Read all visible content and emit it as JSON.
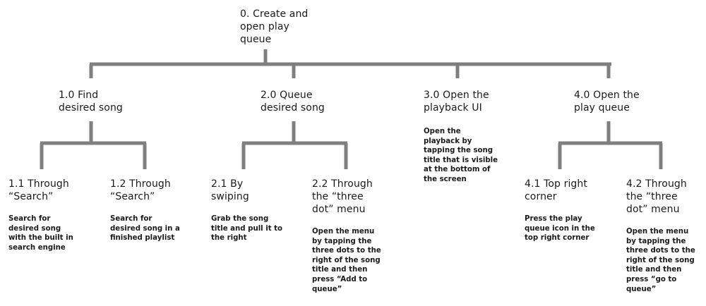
{
  "root": {
    "title": "0. Create and\nopen play\nqueue"
  },
  "steps": [
    {
      "title": "1.0 Find\ndesired song",
      "children": [
        {
          "title": "1.1 Through\n“Search”",
          "description": "Search for\ndesired song\nwith the built in\nsearch engine"
        },
        {
          "title": "1.2 Through\n“Search”",
          "description": "Search for\ndesired song in a\nfinished playlist"
        }
      ]
    },
    {
      "title": "2.0 Queue\ndesired song",
      "children": [
        {
          "title": "2.1 By\nswiping",
          "description": "Grab the song\ntitle and pull it to\nthe right"
        },
        {
          "title": "2.2 Through\nthe “three\ndot” menu",
          "description": "Open the menu\nby tapping the\nthree dots to the\nright of the song\ntitle and then\npress “Add to\nqueue”"
        }
      ]
    },
    {
      "title": "3.0 Open the\nplayback UI",
      "description": "Open the\nplayback by\ntapping the song\ntitle that is visible\nat the bottom of\nthe screen"
    },
    {
      "title": "4.0 Open the\nplay queue",
      "children": [
        {
          "title": "4.1 Top right\ncorner",
          "description": "Press the play\nqueue icon in the\ntop right corner"
        },
        {
          "title": "4.2 Through\nthe “three\ndot” menu",
          "description": "Open the menu\nby tapping the\nthree dots to the\nright of the song\ntitle and then\npress “go to\nqueue”"
        }
      ]
    }
  ],
  "colors": {
    "connector": "#7f7f7f",
    "text": "#1a1a1a"
  }
}
